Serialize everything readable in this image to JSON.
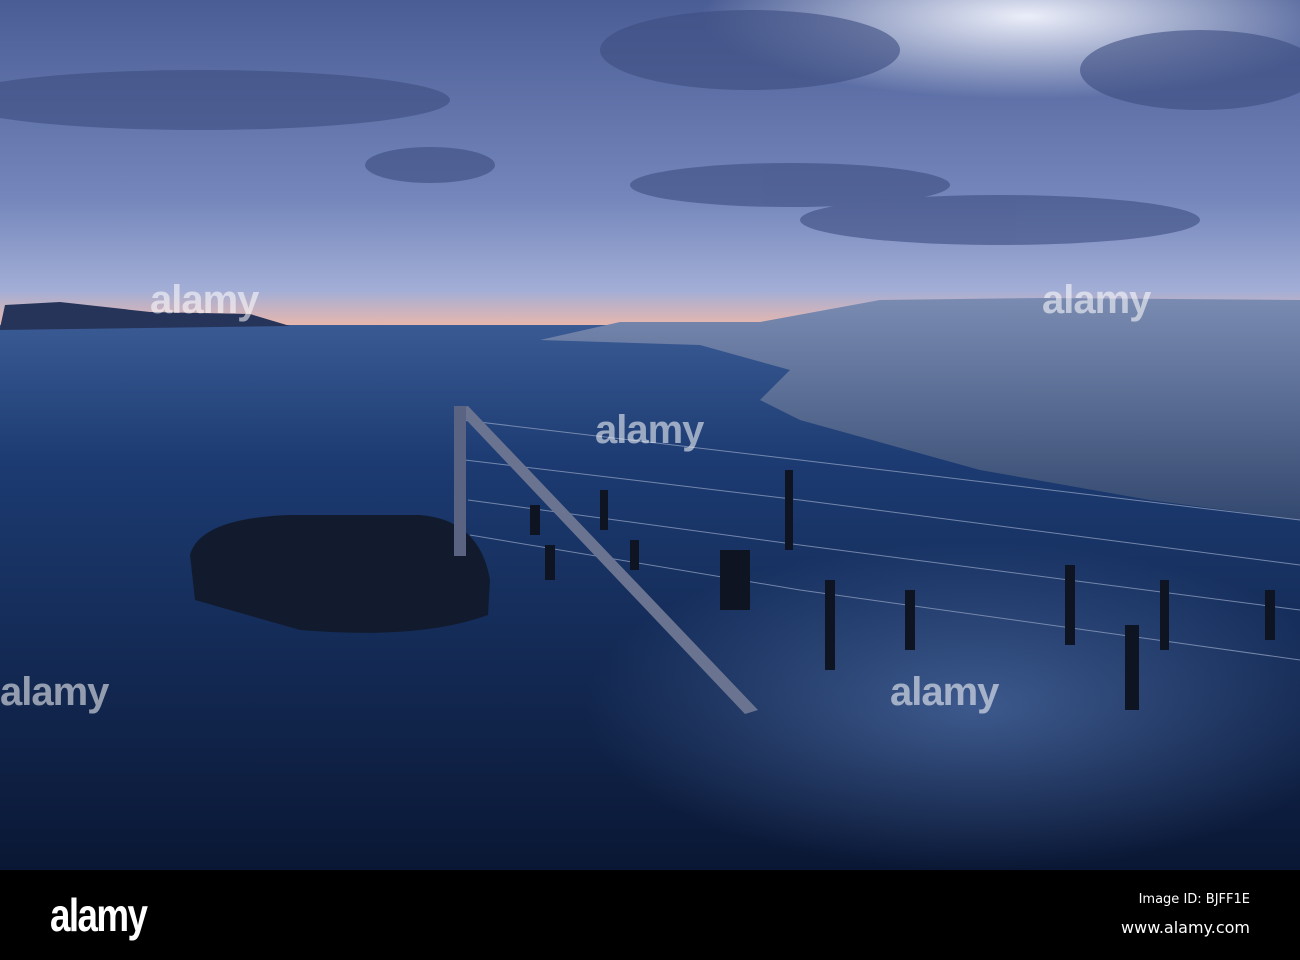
{
  "watermark": {
    "brand": "alamy",
    "dot": "a"
  },
  "footer": {
    "logo": "alamy",
    "image_id": "Image ID: BJFF1E",
    "url": "www.alamy.com"
  },
  "colors": {
    "sky_top": "#4a5d95",
    "sky_horizon": "#9aa8d2",
    "sunset": "#f0b8a8",
    "water": "#1c3b72",
    "water_deep": "#0a1734",
    "rock": "#6d80a8"
  }
}
